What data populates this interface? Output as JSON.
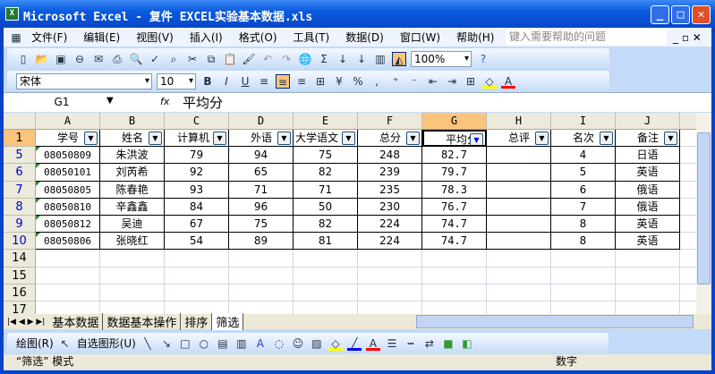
{
  "window": {
    "title": "Microsoft Excel - 复件 EXCEL实验基本数据.xls",
    "min": "_",
    "max": "□",
    "close": "✕"
  },
  "menu": {
    "items": [
      "文件(F)",
      "编辑(E)",
      "视图(V)",
      "插入(I)",
      "格式(O)",
      "工具(T)",
      "数据(D)",
      "窗口(W)",
      "帮助(H)"
    ],
    "help_placeholder": "键入需要帮助的问题"
  },
  "standard_toolbar": {
    "zoom": "100%"
  },
  "format_toolbar": {
    "font": "宋体",
    "size": "10",
    "bold": "B",
    "italic": "I",
    "underline": "U",
    "percent": "%",
    "comma": ","
  },
  "formula_bar": {
    "name_box": "G1",
    "fx": "fx",
    "content": "平均分"
  },
  "sheet": {
    "columns": [
      "A",
      "B",
      "C",
      "D",
      "E",
      "F",
      "G",
      "H",
      "I",
      "J"
    ],
    "headers": [
      "学号",
      "姓名",
      "计算机",
      "外语",
      "大学语文",
      "总分",
      "平均分",
      "总评",
      "名次",
      "备注"
    ],
    "rows": [
      {
        "num": "5",
        "cells": [
          "08050809",
          "朱洪波",
          "79",
          "94",
          "75",
          "248",
          "82.7",
          "",
          "4",
          "日语"
        ]
      },
      {
        "num": "6",
        "cells": [
          "08050101",
          "刘芮希",
          "92",
          "65",
          "82",
          "239",
          "79.7",
          "",
          "5",
          "英语"
        ]
      },
      {
        "num": "7",
        "cells": [
          "08050805",
          "陈春艳",
          "93",
          "71",
          "71",
          "235",
          "78.3",
          "",
          "6",
          "俄语"
        ]
      },
      {
        "num": "8",
        "cells": [
          "08050810",
          "辛鑫鑫",
          "84",
          "96",
          "50",
          "230",
          "76.7",
          "",
          "7",
          "俄语"
        ]
      },
      {
        "num": "9",
        "cells": [
          "08050812",
          "吴迪",
          "67",
          "75",
          "82",
          "224",
          "74.7",
          "",
          "8",
          "英语"
        ]
      },
      {
        "num": "10",
        "cells": [
          "08050806",
          "张晓红",
          "54",
          "89",
          "81",
          "224",
          "74.7",
          "",
          "8",
          "英语"
        ]
      }
    ],
    "empty_rows": [
      "14",
      "15",
      "16",
      "17"
    ],
    "header_row_num": "1"
  },
  "sheet_tabs": [
    "基本数据",
    "数据基本操作",
    "排序",
    "筛选"
  ],
  "active_tab": "筛选",
  "drawing_toolbar": {
    "draw": "绘图(R)",
    "autoshapes": "自选图形(U)"
  },
  "status": {
    "mode": "“筛选” 模式",
    "num": "数字"
  }
}
